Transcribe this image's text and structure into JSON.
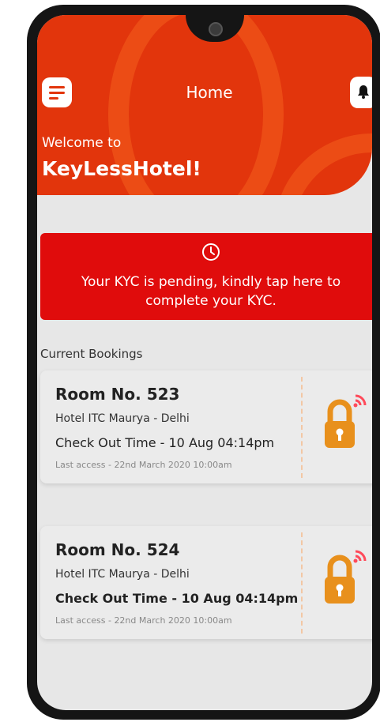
{
  "header": {
    "title": "Home",
    "welcome": "Welcome to",
    "brand": "KeyLessHotel!"
  },
  "kyc": {
    "message_line1": "Your KYC is pending, kindly tap here to",
    "message_line2": "complete your KYC."
  },
  "bookings": {
    "heading": "Current Bookings",
    "items": [
      {
        "room": "Room No. 523",
        "hotel": "Hotel ITC Maurya - Delhi",
        "checkout": "Check Out Time - 10 Aug  04:14pm",
        "last_access": "Last access -  22nd March 2020    10:00am"
      },
      {
        "room": "Room No. 524",
        "hotel": "Hotel ITC Maurya - Delhi",
        "checkout": "Check Out Time - 10 Aug  04:14pm",
        "last_access": "Last access -  22nd March 2020    10:00am"
      }
    ]
  },
  "icons": {
    "menu": "menu-icon",
    "bell": "bell-icon",
    "clock": "clock-icon",
    "lock": "padlock-wifi-icon"
  },
  "colors": {
    "header_bg": "#e2350c",
    "kyc_bg": "#e00c0c",
    "lock": "#e8901c",
    "wifi": "#ff4a5a"
  }
}
